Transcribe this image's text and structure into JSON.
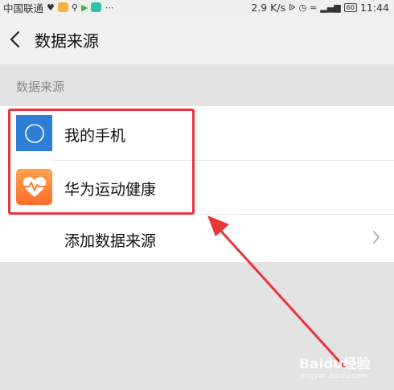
{
  "status_bar": {
    "carrier": "中国联通",
    "speed": "2.9 K/s",
    "battery": "60",
    "time": "11:44"
  },
  "header": {
    "title": "数据来源"
  },
  "section": {
    "label": "数据来源"
  },
  "sources": [
    {
      "label": "我的手机",
      "icon": "phone-circle-icon"
    },
    {
      "label": "华为运动健康",
      "icon": "huawei-health-icon"
    }
  ],
  "add_source": {
    "label": "添加数据来源"
  },
  "watermark": {
    "text": "Baidu经验",
    "sub": "jingyan.baidu.com"
  },
  "colors": {
    "phone_icon_bg": "#2d7fd6",
    "health_icon_bg": "#ff7e33",
    "highlight": "#e8343b"
  }
}
